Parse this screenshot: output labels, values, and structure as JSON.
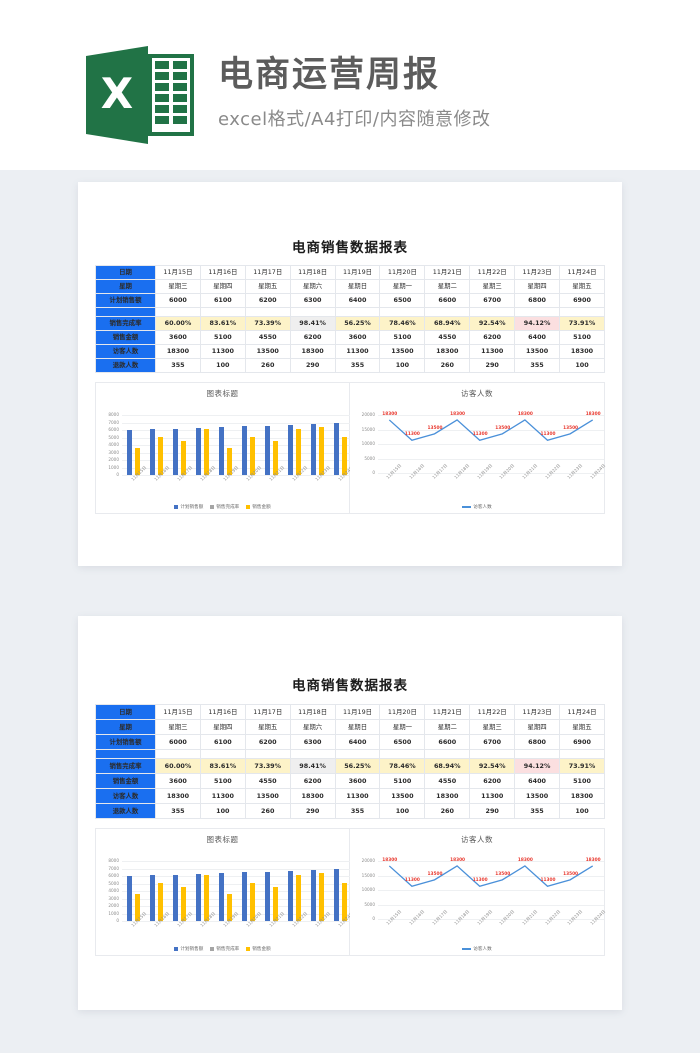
{
  "header": {
    "logo_letter": "X",
    "title": "电商运营周报",
    "subtitle": "excel格式/A4打印/内容随意修改"
  },
  "report": {
    "title": "电商销售数据报表",
    "row_labels": {
      "date": "日期",
      "weekday": "星期",
      "plan_sales": "计划销售额",
      "completion_rate": "销售完成率",
      "sales_amount": "销售金额",
      "visitors": "访客人数",
      "refunds": "退款人数"
    },
    "dates": [
      "11月15日",
      "11月16日",
      "11月17日",
      "11月18日",
      "11月19日",
      "11月20日",
      "11月21日",
      "11月22日",
      "11月23日",
      "11月24日"
    ],
    "weekdays": [
      "星期三",
      "星期四",
      "星期五",
      "星期六",
      "星期日",
      "星期一",
      "星期二",
      "星期三",
      "星期四",
      "星期五"
    ],
    "plan_sales": [
      6000,
      6100,
      6200,
      6300,
      6400,
      6500,
      6600,
      6700,
      6800,
      6900
    ],
    "completion_rate": [
      "60.00%",
      "83.61%",
      "73.39%",
      "98.41%",
      "56.25%",
      "78.46%",
      "68.94%",
      "92.54%",
      "94.12%",
      "73.91%"
    ],
    "completion_rate_style": [
      "normal",
      "normal",
      "normal",
      "gray",
      "normal",
      "normal",
      "normal",
      "normal",
      "pink",
      "normal"
    ],
    "sales_amount": [
      3600,
      5100,
      4550,
      6200,
      3600,
      5100,
      4550,
      6200,
      6400,
      5100
    ],
    "visitors": [
      18300,
      11300,
      13500,
      18300,
      11300,
      13500,
      18300,
      11300,
      13500,
      18300
    ],
    "refunds": [
      355,
      100,
      260,
      290,
      355,
      100,
      260,
      290,
      355,
      100
    ]
  },
  "colors": {
    "header_blue": "#1a6ff0",
    "bar_plan": "#4472c4",
    "bar_amount": "#ffc000",
    "bar_rate": "#a5a5a5",
    "line": "#4a90d9",
    "rate_yellow_bg": "#fdf3c8",
    "rate_yellow_fg": "#d79012",
    "rate_pink_bg": "#fbdfe0",
    "rate_pink_fg": "#e0454b",
    "rate_gray_bg": "#efefef",
    "rate_gray_fg": "#cfcfcf",
    "label_red": "#e8392f",
    "logo_green": "#217346"
  },
  "chart_data": [
    {
      "type": "bar",
      "title": "图表标题",
      "categories": [
        "11月15日",
        "11月16日",
        "11月17日",
        "11月18日",
        "11月19日",
        "11月20日",
        "11月21日",
        "11月22日",
        "11月23日",
        "11月24日"
      ],
      "series": [
        {
          "name": "计划销售额",
          "values": [
            6000,
            6100,
            6200,
            6300,
            6400,
            6500,
            6600,
            6700,
            6800,
            6900
          ],
          "color": "#4472c4"
        },
        {
          "name": "销售完成率",
          "values": [
            0.6,
            0.8361,
            0.7339,
            0.9841,
            0.5625,
            0.7846,
            0.6894,
            0.9254,
            0.9412,
            0.7391
          ],
          "color": "#a5a5a5"
        },
        {
          "name": "销售金额",
          "values": [
            3600,
            5100,
            4550,
            6200,
            3600,
            5100,
            4550,
            6200,
            6400,
            5100
          ],
          "color": "#ffc000"
        }
      ],
      "ylabel": "",
      "xlabel": "",
      "ylim": [
        0,
        8000
      ],
      "yticks": [
        0,
        1000,
        2000,
        3000,
        4000,
        5000,
        6000,
        7000,
        8000
      ],
      "grid": true,
      "legend_position": "bottom"
    },
    {
      "type": "line",
      "title": "访客人数",
      "categories": [
        "11月15日",
        "11月16日",
        "11月17日",
        "11月18日",
        "11月19日",
        "11月20日",
        "11月21日",
        "11月22日",
        "11月23日",
        "11月24日"
      ],
      "series": [
        {
          "name": "访客人数",
          "values": [
            18300,
            11300,
            13500,
            18300,
            11300,
            13500,
            18300,
            11300,
            13500,
            18300
          ],
          "color": "#4a90d9"
        }
      ],
      "data_labels": [
        "18300",
        "11300",
        "13500",
        "18300",
        "11300",
        "13500",
        "18300",
        "11300",
        "13500",
        "18300"
      ],
      "ylabel": "",
      "xlabel": "",
      "ylim": [
        0,
        20000
      ],
      "yticks": [
        0,
        5000,
        10000,
        15000,
        20000
      ],
      "grid": true,
      "legend_position": "bottom"
    }
  ]
}
